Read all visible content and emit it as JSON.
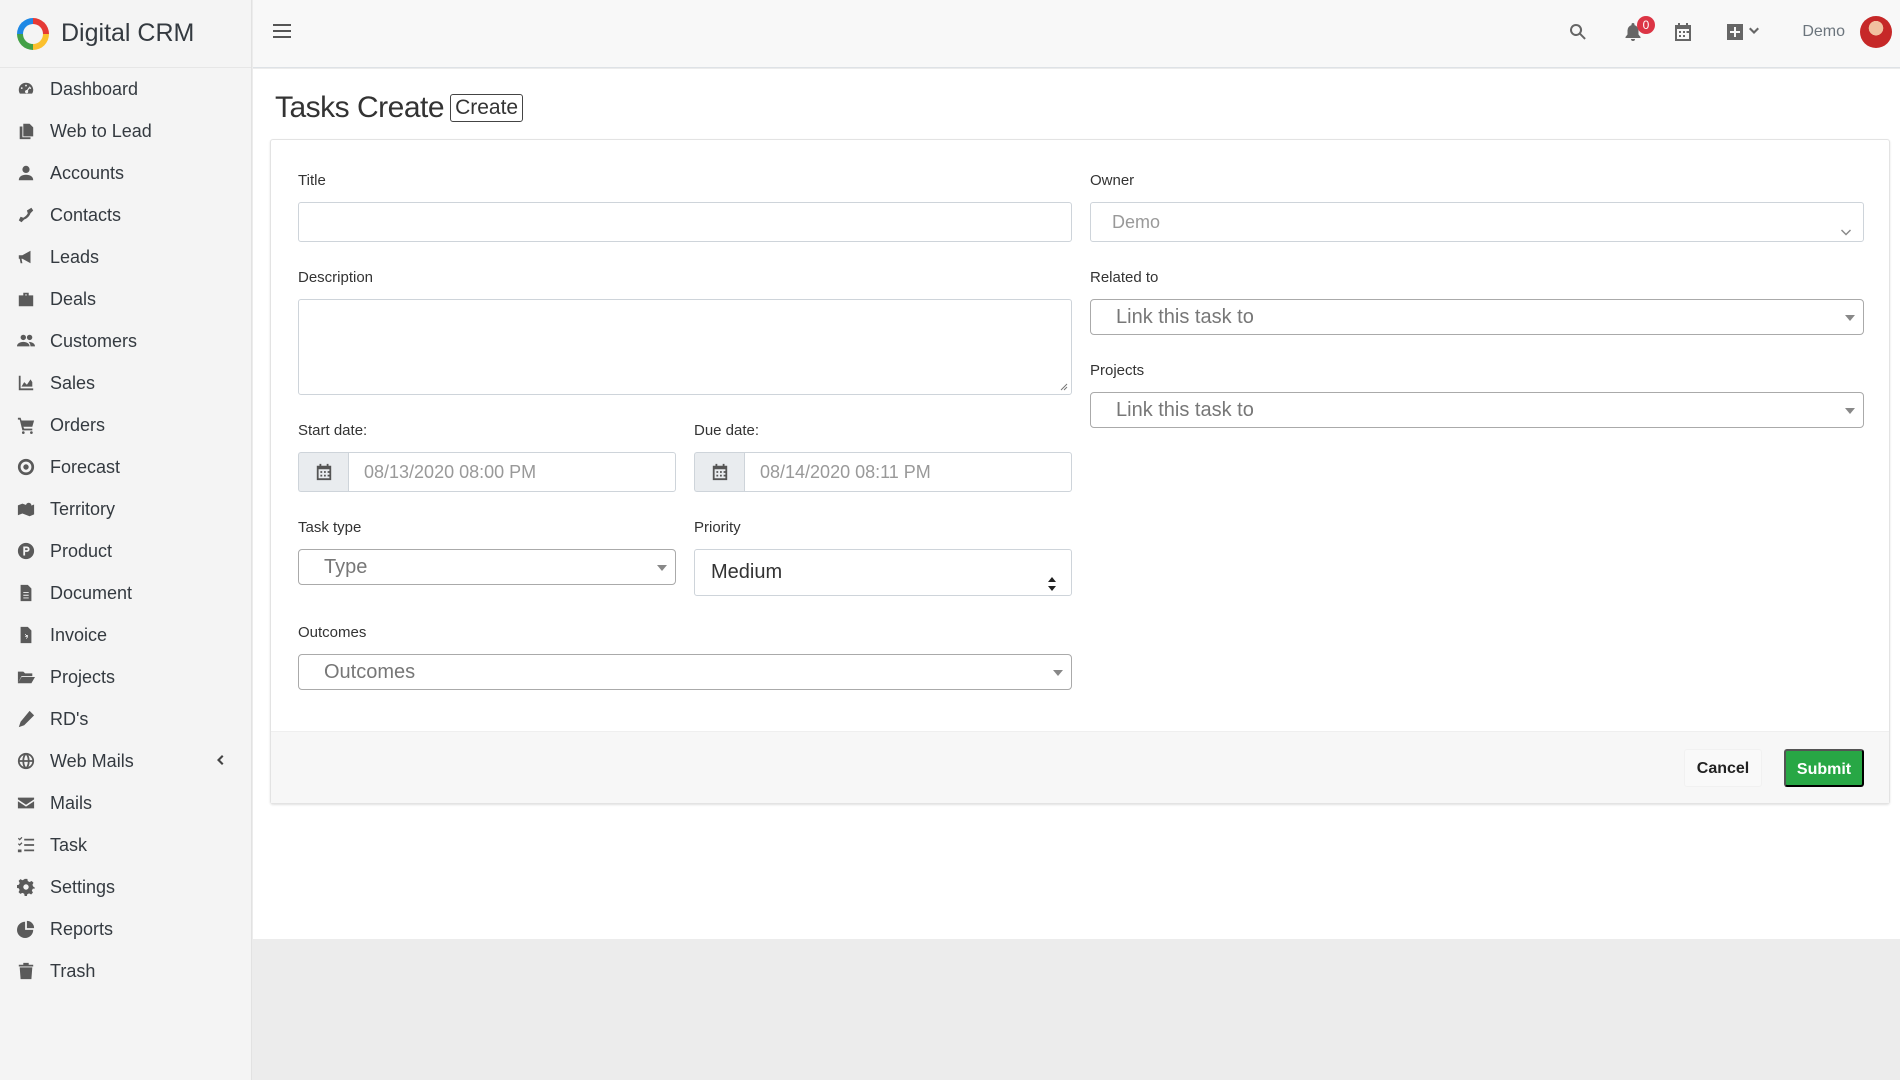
{
  "app": {
    "name": "Digital CRM"
  },
  "sidebar": {
    "items": [
      {
        "label": "Dashboard",
        "icon": "dashboard-icon"
      },
      {
        "label": "Web to Lead",
        "icon": "copy-icon"
      },
      {
        "label": "Accounts",
        "icon": "user-icon"
      },
      {
        "label": "Contacts",
        "icon": "phone-icon"
      },
      {
        "label": "Leads",
        "icon": "megaphone-icon"
      },
      {
        "label": "Deals",
        "icon": "briefcase-icon"
      },
      {
        "label": "Customers",
        "icon": "users-icon"
      },
      {
        "label": "Sales",
        "icon": "area-chart-icon"
      },
      {
        "label": "Orders",
        "icon": "cart-icon"
      },
      {
        "label": "Forecast",
        "icon": "target-icon"
      },
      {
        "label": "Territory",
        "icon": "map-marker-icon"
      },
      {
        "label": "Product",
        "icon": "product-icon"
      },
      {
        "label": "Document",
        "icon": "document-icon"
      },
      {
        "label": "Invoice",
        "icon": "invoice-icon"
      },
      {
        "label": "Projects",
        "icon": "folder-open-icon"
      },
      {
        "label": "RD's",
        "icon": "pen-icon"
      },
      {
        "label": "Web Mails",
        "icon": "globe-icon"
      },
      {
        "label": "Mails",
        "icon": "envelope-icon"
      },
      {
        "label": "Task",
        "icon": "tasks-icon"
      },
      {
        "label": "Settings",
        "icon": "gear-icon"
      },
      {
        "label": "Reports",
        "icon": "pie-chart-icon"
      },
      {
        "label": "Trash",
        "icon": "trash-icon"
      }
    ]
  },
  "topbar": {
    "notification_count": "0",
    "user_name": "Demo"
  },
  "page": {
    "title": "Tasks Create",
    "tag": "Create"
  },
  "form": {
    "title_label": "Title",
    "title_value": "",
    "owner_label": "Owner",
    "owner_value": "Demo",
    "description_label": "Description",
    "related_label": "Related to",
    "related_placeholder": "Link this task to",
    "projects_label": "Projects",
    "projects_placeholder": "Link this task to",
    "start_label": "Start date:",
    "start_value": "08/13/2020 08:00 PM",
    "due_label": "Due date:",
    "due_value": "08/14/2020 08:11 PM",
    "task_type_label": "Task type",
    "task_type_placeholder": "Type",
    "priority_label": "Priority",
    "priority_value": "Medium",
    "outcomes_label": "Outcomes",
    "outcomes_placeholder": "Outcomes"
  },
  "footer": {
    "cancel_label": "Cancel",
    "submit_label": "Submit"
  },
  "colors": {
    "submit": "#28a745",
    "badge": "#dc3545"
  }
}
